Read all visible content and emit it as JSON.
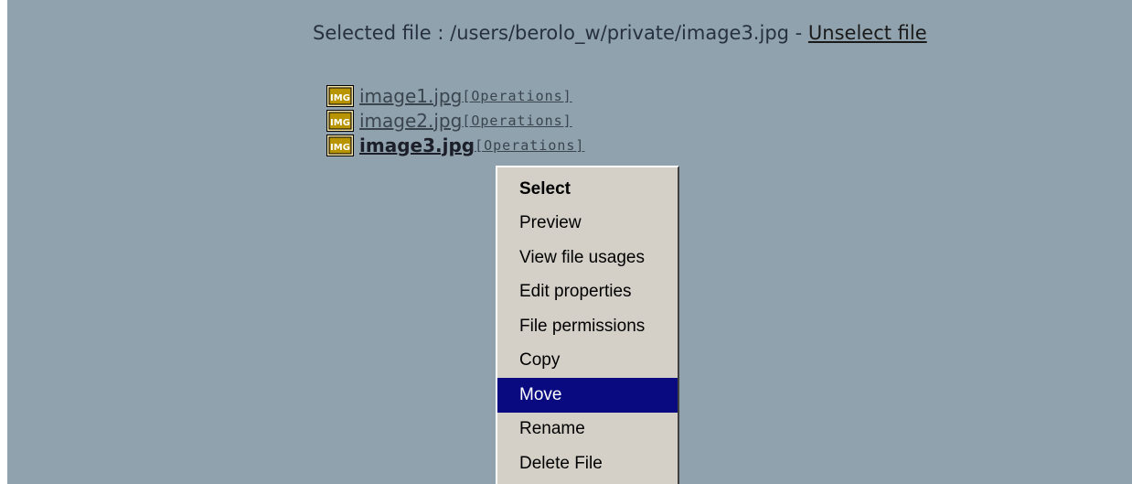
{
  "selection": {
    "prefix": "Selected file : /users/berolo_w/private/image3.jpg - ",
    "unselect_label": "Unselect file"
  },
  "files": [
    {
      "name": "image1.jpg",
      "operations": "[Operations]",
      "icon": "img-file-icon",
      "current": false
    },
    {
      "name": "image2.jpg",
      "operations": "[Operations]",
      "icon": "img-file-icon",
      "current": false
    },
    {
      "name": "image3.jpg",
      "operations": "[Operations]",
      "icon": "img-file-icon",
      "current": true
    }
  ],
  "icon_label": "IMG",
  "context_menu": {
    "items": [
      {
        "label": "Select",
        "default": true
      },
      {
        "label": "Preview"
      },
      {
        "label": "View file usages"
      },
      {
        "label": "Edit properties"
      },
      {
        "label": "File permissions"
      },
      {
        "label": "Copy"
      },
      {
        "label": "Move",
        "highlighted": true
      },
      {
        "label": "Rename"
      },
      {
        "label": "Delete File"
      }
    ]
  },
  "colors": {
    "background": "#8fa2ad",
    "menu_background": "#d4d0c8",
    "menu_highlight": "#0a0a80",
    "icon_gold": "#c8a000"
  }
}
